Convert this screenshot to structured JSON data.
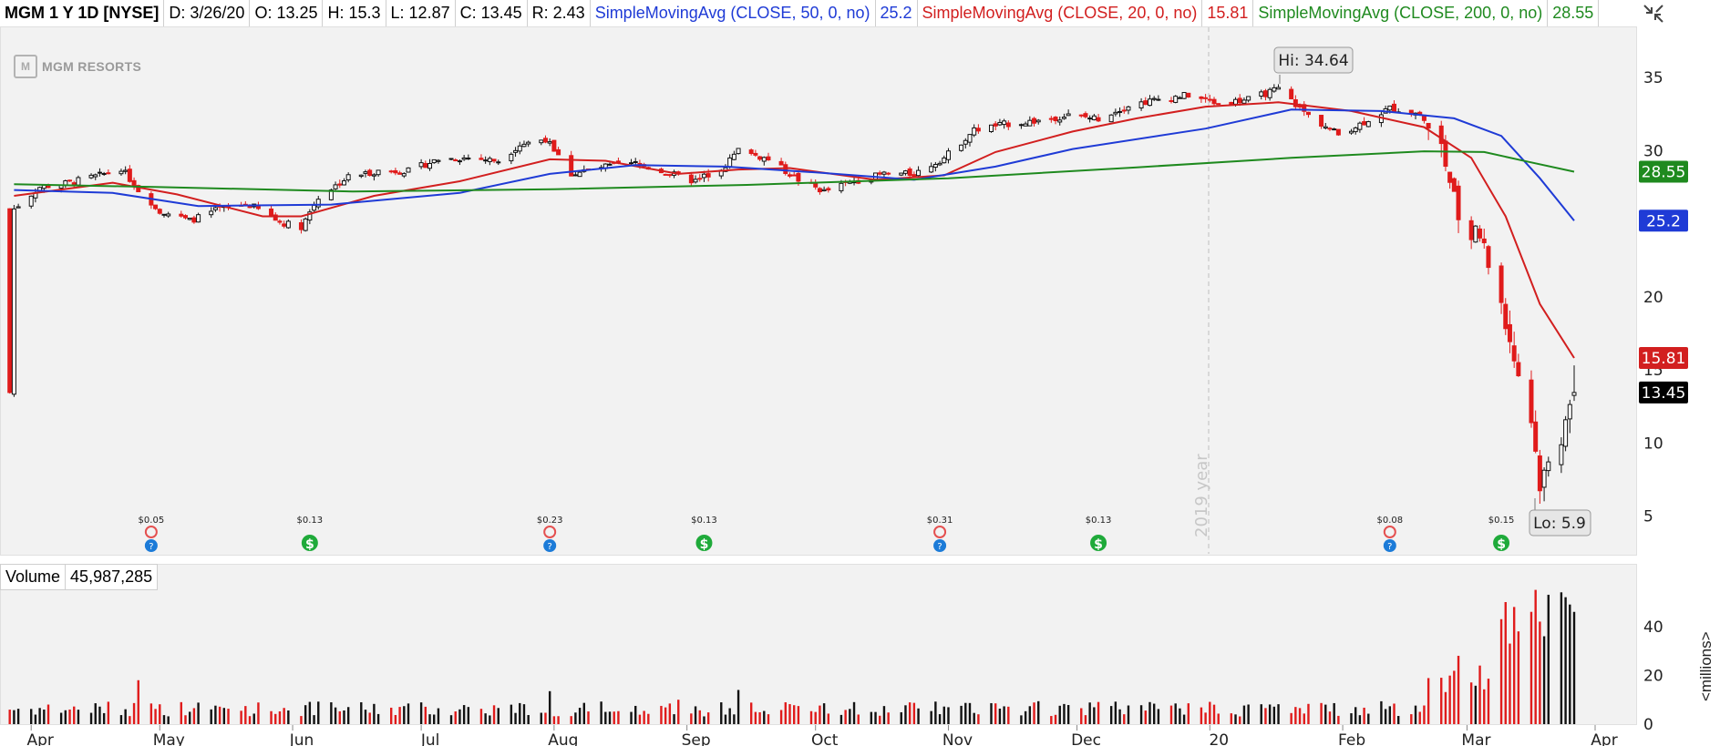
{
  "header": {
    "symbol": "MGM 1 Y 1D [NYSE]",
    "date": "D: 3/26/20",
    "open": "O: 13.25",
    "high": "H: 15.3",
    "low": "L: 12.87",
    "close": "C: 13.45",
    "range": "R: 2.43",
    "sma50_label": "SimpleMovingAvg (CLOSE, 50, 0, no)",
    "sma50_value": "25.2",
    "sma20_label": "SimpleMovingAvg (CLOSE, 20, 0, no)",
    "sma20_value": "15.81",
    "sma200_label": "SimpleMovingAvg (CLOSE, 200, 0, no)",
    "sma200_value": "28.55"
  },
  "logo": {
    "text": "MGM RESORTS",
    "mark": "M"
  },
  "annotations": {
    "hi": "Hi: 34.64",
    "lo": "Lo: 5.9",
    "year": "2019 year"
  },
  "volume": {
    "label": "Volume",
    "value": "45,987,285",
    "units": "<millions>"
  },
  "colors": {
    "up": "#111111",
    "down": "#e01b1b",
    "sma20": "#d21f1f",
    "sma50": "#1f3bd6",
    "sma200": "#1f8a1f",
    "pane": "#f2f2f2",
    "dividend": "#1faa3a",
    "earnings_up": "#1c7bd8",
    "earnings_down": "#e45050"
  },
  "chart_data": [
    {
      "type": "candlestick",
      "title": "MGM 1 Y 1D [NYSE]",
      "x_axis": {
        "type": "date",
        "tick_labels": [
          "Apr",
          "May",
          "Jun",
          "Jul",
          "Aug",
          "Sep",
          "Oct",
          "Nov",
          "Dec",
          "20",
          "Feb",
          "Mar",
          "Apr"
        ]
      },
      "y_axis": {
        "ticks": [
          5,
          10,
          15,
          20,
          25,
          30,
          35
        ],
        "tick_labels": [
          "5",
          "10",
          "15",
          "20",
          "",
          "30",
          "35"
        ],
        "range": [
          4,
          37
        ],
        "position": "right"
      },
      "grid": false,
      "ohlc_last": {
        "date": "3/26/20",
        "open": 13.25,
        "high": 15.3,
        "low": 12.87,
        "close": 13.45
      },
      "hi": 34.64,
      "lo": 5.9,
      "close_path": [
        [
          "2019-03-28",
          26.0
        ],
        [
          "2019-04-03",
          27.5
        ],
        [
          "2019-04-10",
          27.8
        ],
        [
          "2019-04-17",
          28.3
        ],
        [
          "2019-04-22",
          28.8
        ],
        [
          "2019-04-26",
          27.3
        ],
        [
          "2019-05-01",
          25.9
        ],
        [
          "2019-05-08",
          25.2
        ],
        [
          "2019-05-15",
          26.0
        ],
        [
          "2019-05-22",
          26.3
        ],
        [
          "2019-05-29",
          25.1
        ],
        [
          "2019-06-03",
          24.8
        ],
        [
          "2019-06-07",
          26.8
        ],
        [
          "2019-06-14",
          28.2
        ],
        [
          "2019-06-21",
          28.6
        ],
        [
          "2019-06-28",
          28.6
        ],
        [
          "2019-07-05",
          29.4
        ],
        [
          "2019-07-12",
          29.5
        ],
        [
          "2019-07-19",
          29.3
        ],
        [
          "2019-07-24",
          30.4
        ],
        [
          "2019-07-30",
          30.8
        ],
        [
          "2019-08-05",
          28.4
        ],
        [
          "2019-08-13",
          28.9
        ],
        [
          "2019-08-20",
          29.1
        ],
        [
          "2019-08-27",
          28.5
        ],
        [
          "2019-09-03",
          27.9
        ],
        [
          "2019-09-10",
          29.0
        ],
        [
          "2019-09-13",
          30.0
        ],
        [
          "2019-09-20",
          29.4
        ],
        [
          "2019-09-27",
          28.0
        ],
        [
          "2019-10-03",
          27.2
        ],
        [
          "2019-10-10",
          27.9
        ],
        [
          "2019-10-17",
          28.4
        ],
        [
          "2019-10-24",
          28.4
        ],
        [
          "2019-10-31",
          29.5
        ],
        [
          "2019-11-07",
          31.4
        ],
        [
          "2019-11-14",
          31.8
        ],
        [
          "2019-11-21",
          32.0
        ],
        [
          "2019-11-29",
          32.4
        ],
        [
          "2019-12-06",
          32.2
        ],
        [
          "2019-12-13",
          33.1
        ],
        [
          "2019-12-20",
          33.5
        ],
        [
          "2019-12-27",
          33.8
        ],
        [
          "2020-01-03",
          33.2
        ],
        [
          "2020-01-10",
          33.5
        ],
        [
          "2020-01-17",
          34.2
        ],
        [
          "2020-01-24",
          32.4
        ],
        [
          "2020-01-31",
          31.1
        ],
        [
          "2020-02-05",
          31.8
        ],
        [
          "2020-02-12",
          32.9
        ],
        [
          "2020-02-19",
          32.5
        ],
        [
          "2020-02-24",
          30.3
        ],
        [
          "2020-02-28",
          25.5
        ],
        [
          "2020-03-04",
          24.0
        ],
        [
          "2020-03-09",
          19.6
        ],
        [
          "2020-03-12",
          15.8
        ],
        [
          "2020-03-16",
          11.6
        ],
        [
          "2020-03-18",
          7.2
        ],
        [
          "2020-03-20",
          8.5
        ],
        [
          "2020-03-23",
          10.4
        ],
        [
          "2020-03-24",
          12.1
        ],
        [
          "2020-03-26",
          13.45
        ]
      ],
      "series": [
        {
          "name": "SimpleMovingAvg (CLOSE, 20, 0, no)",
          "last": 15.81,
          "points": [
            [
              "2019-03-28",
              26.9
            ],
            [
              "2019-04-20",
              27.8
            ],
            [
              "2019-05-05",
              27.0
            ],
            [
              "2019-05-25",
              25.5
            ],
            [
              "2019-06-03",
              25.5
            ],
            [
              "2019-06-20",
              26.9
            ],
            [
              "2019-07-10",
              27.9
            ],
            [
              "2019-07-31",
              29.4
            ],
            [
              "2019-08-13",
              29.3
            ],
            [
              "2019-08-30",
              28.4
            ],
            [
              "2019-09-13",
              28.7
            ],
            [
              "2019-09-25",
              28.8
            ],
            [
              "2019-10-15",
              28.0
            ],
            [
              "2019-10-31",
              28.3
            ],
            [
              "2019-11-12",
              29.9
            ],
            [
              "2019-11-30",
              31.3
            ],
            [
              "2019-12-15",
              32.2
            ],
            [
              "2019-12-31",
              33.0
            ],
            [
              "2020-01-17",
              33.3
            ],
            [
              "2020-02-03",
              32.7
            ],
            [
              "2020-02-20",
              31.6
            ],
            [
              "2020-03-02",
              29.5
            ],
            [
              "2020-03-10",
              25.5
            ],
            [
              "2020-03-18",
              19.5
            ],
            [
              "2020-03-26",
              15.81
            ]
          ]
        },
        {
          "name": "SimpleMovingAvg (CLOSE, 50, 0, no)",
          "last": 25.2,
          "points": [
            [
              "2019-03-28",
              27.3
            ],
            [
              "2019-04-20",
              27.1
            ],
            [
              "2019-05-10",
              26.2
            ],
            [
              "2019-06-10",
              26.3
            ],
            [
              "2019-07-10",
              27.1
            ],
            [
              "2019-07-31",
              28.4
            ],
            [
              "2019-08-20",
              29.0
            ],
            [
              "2019-09-10",
              28.9
            ],
            [
              "2019-10-01",
              28.5
            ],
            [
              "2019-10-24",
              28.0
            ],
            [
              "2019-11-12",
              28.9
            ],
            [
              "2019-11-30",
              30.1
            ],
            [
              "2019-12-31",
              31.5
            ],
            [
              "2020-01-20",
              32.8
            ],
            [
              "2020-02-10",
              32.7
            ],
            [
              "2020-02-27",
              32.2
            ],
            [
              "2020-03-09",
              31.0
            ],
            [
              "2020-03-18",
              28.1
            ],
            [
              "2020-03-26",
              25.2
            ]
          ]
        },
        {
          "name": "SimpleMovingAvg (CLOSE, 200, 0, no)",
          "last": 28.55,
          "points": [
            [
              "2019-03-28",
              27.7
            ],
            [
              "2019-05-01",
              27.5
            ],
            [
              "2019-06-15",
              27.2
            ],
            [
              "2019-08-01",
              27.35
            ],
            [
              "2019-09-15",
              27.65
            ],
            [
              "2019-11-01",
              28.1
            ],
            [
              "2019-12-15",
              28.85
            ],
            [
              "2020-01-20",
              29.5
            ],
            [
              "2020-02-20",
              29.95
            ],
            [
              "2020-03-05",
              29.9
            ],
            [
              "2020-03-15",
              29.25
            ],
            [
              "2020-03-26",
              28.55
            ]
          ]
        }
      ],
      "events": [
        {
          "date": "2019-04-29",
          "kind": "earnings",
          "value": "$0.05",
          "beat": false
        },
        {
          "date": "2019-06-05",
          "kind": "dividend",
          "value": "$0.13"
        },
        {
          "date": "2019-07-31",
          "kind": "earnings",
          "value": "$0.23",
          "beat": false
        },
        {
          "date": "2019-09-05",
          "kind": "dividend",
          "value": "$0.13"
        },
        {
          "date": "2019-10-30",
          "kind": "earnings",
          "value": "$0.31",
          "beat": false
        },
        {
          "date": "2019-12-06",
          "kind": "dividend",
          "value": "$0.13"
        },
        {
          "date": "2020-02-12",
          "kind": "earnings",
          "value": "$0.08",
          "beat": false
        },
        {
          "date": "2020-03-09",
          "kind": "dividend",
          "value": "$0.15"
        }
      ]
    },
    {
      "type": "bar",
      "title": "Volume",
      "y_axis": {
        "ticks": [
          0,
          20,
          40
        ],
        "tick_labels": [
          "0",
          "20",
          "40"
        ],
        "range": [
          0,
          55
        ],
        "units": "<millions>"
      },
      "last": 45.987285,
      "daily_millions_sample": {
        "typical_2019": 7.0,
        "spikes": [
          [
            "2019-04-26",
            18.0
          ],
          [
            "2019-07-31",
            13.5
          ],
          [
            "2019-09-13",
            14.0
          ],
          [
            "2019-08-30",
            10.0
          ]
        ],
        "march_2020": [
          [
            "2020-02-24",
            19.0
          ],
          [
            "2020-02-28",
            28.0
          ],
          [
            "2020-03-04",
            24.0
          ],
          [
            "2020-03-09",
            43.0
          ],
          [
            "2020-03-10",
            50.0
          ],
          [
            "2020-03-11",
            33.0
          ],
          [
            "2020-03-12",
            48.0
          ],
          [
            "2020-03-13",
            38.0
          ],
          [
            "2020-03-16",
            46.0
          ],
          [
            "2020-03-17",
            55.0
          ],
          [
            "2020-03-18",
            42.0
          ],
          [
            "2020-03-19",
            36.0
          ],
          [
            "2020-03-20",
            53.0
          ],
          [
            "2020-03-23",
            54.0
          ],
          [
            "2020-03-24",
            52.0
          ],
          [
            "2020-03-25",
            49.0
          ],
          [
            "2020-03-26",
            45.987285
          ]
        ]
      }
    }
  ]
}
